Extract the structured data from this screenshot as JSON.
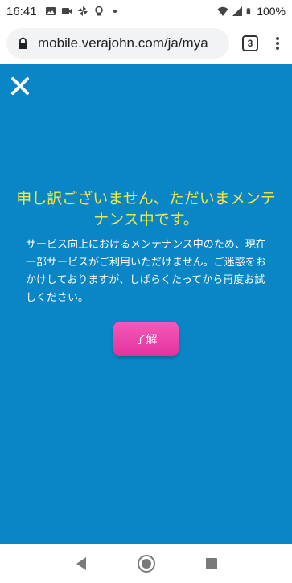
{
  "status_bar": {
    "time": "16:41",
    "battery": "100%",
    "left_icons": [
      "photo-icon",
      "video-icon",
      "pinwheel-icon",
      "lightbulb-icon",
      "dot-icon"
    ],
    "right_icons": [
      "wifi-icon",
      "signal-icon",
      "battery-icon"
    ]
  },
  "browser": {
    "url": "mobile.verajohn.com/ja/mya",
    "tab_count": "3",
    "lock_icon": "lock-icon",
    "menu_icon": "more-vert-icon"
  },
  "maintenance": {
    "close_icon": "close-icon",
    "headline": "申し訳ございません、ただいまメンテナンス中です。",
    "message": "サービス向上におけるメンテナンス中のため、現在一部サービスがご利用いただけません。ご迷惑をおかけしておりますが、しばらくたってから再度お試しください。",
    "ok_label": "了解",
    "colors": {
      "background": "#0a86c6",
      "headline": "#f5e642",
      "button": "#ea3ea7"
    }
  },
  "nav_bar": {
    "back_icon": "back-icon",
    "home_icon": "home-icon",
    "recents_icon": "recents-icon"
  }
}
